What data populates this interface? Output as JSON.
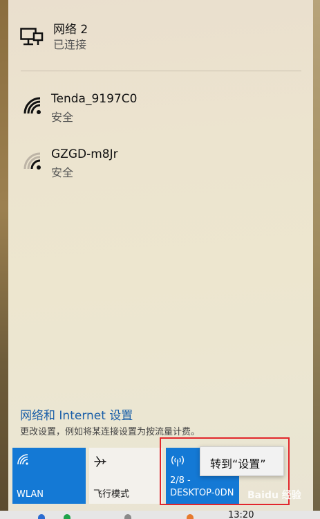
{
  "networks": [
    {
      "name": "网络 2",
      "status": "已连接",
      "icon": "ethernet-icon"
    },
    {
      "name": "Tenda_9197C0",
      "status": "安全",
      "icon": "wifi-strong-icon"
    },
    {
      "name": "GZGD-m8Jr",
      "status": "安全",
      "icon": "wifi-weak-icon"
    }
  ],
  "settings": {
    "link": "网络和 Internet 设置",
    "description": "更改设置，例如将某连接设置为按流量计费。"
  },
  "tiles": [
    {
      "label": "WLAN",
      "icon": "wifi-icon",
      "active": true
    },
    {
      "label": "飞行模式",
      "icon": "airplane-icon",
      "active": false
    },
    {
      "label_line1": "2/8 -",
      "label_line2": "DESKTOP-0DN",
      "icon": "hotspot-icon",
      "active": true
    }
  ],
  "tooltip": {
    "text": "转到“设置”"
  },
  "taskbar": {
    "clock": "13:20"
  },
  "watermark": {
    "text": "Baidu 经验"
  },
  "colors": {
    "accent": "#1479d5",
    "link": "#1a5fa8",
    "highlight": "#e2262b"
  }
}
